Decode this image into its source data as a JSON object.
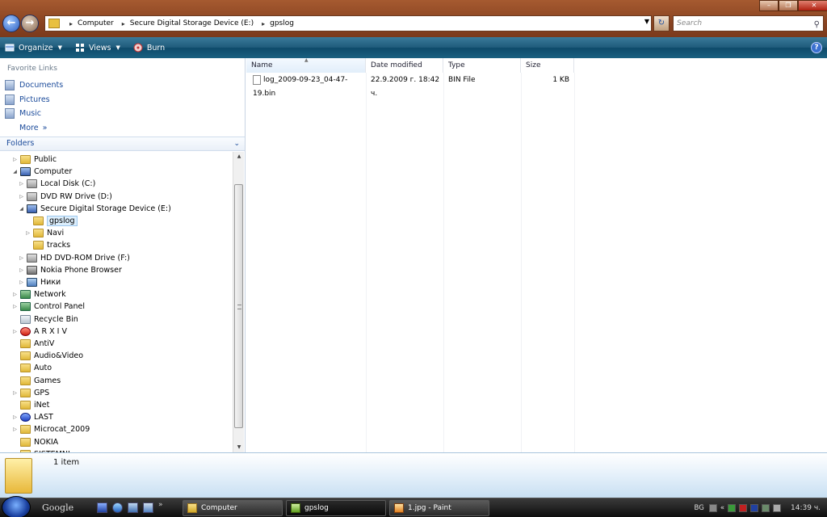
{
  "window": {
    "address": {
      "crumbs": [
        "Computer",
        "Secure Digital Storage Device (E:)",
        "gpslog"
      ],
      "separator": "▸"
    },
    "search_placeholder": "Search"
  },
  "toolbar": {
    "organize": "Organize",
    "views": "Views",
    "burn": "Burn",
    "help": "?"
  },
  "sidebar": {
    "favorites_heading": "Favorite Links",
    "favorites": [
      "Documents",
      "Pictures",
      "Music",
      "More"
    ],
    "more_suffix": "»",
    "folders_heading": "Folders",
    "tree": [
      {
        "label": "Public",
        "level": 1,
        "expander": "▷",
        "icon": "folder-icon"
      },
      {
        "label": "Computer",
        "level": 1,
        "expander": "◢",
        "icon": "computer-icon"
      },
      {
        "label": "Local Disk (C:)",
        "level": 2,
        "expander": "▷",
        "icon": "hard-drive-icon"
      },
      {
        "label": "DVD RW Drive (D:)",
        "level": 2,
        "expander": "▷",
        "icon": "dvd-drive-icon"
      },
      {
        "label": "Secure Digital Storage Device (E:)",
        "level": 2,
        "expander": "◢",
        "icon": "usb-drive-icon"
      },
      {
        "label": "gpslog",
        "level": 3,
        "expander": "",
        "icon": "folder-icon",
        "selected": true
      },
      {
        "label": "Navi",
        "level": 3,
        "expander": "▷",
        "icon": "folder-icon"
      },
      {
        "label": "tracks",
        "level": 3,
        "expander": "",
        "icon": "folder-icon"
      },
      {
        "label": "HD DVD-ROM Drive (F:)",
        "level": 2,
        "expander": "▷",
        "icon": "dvd-drive-icon"
      },
      {
        "label": "Nokia Phone Browser",
        "level": 2,
        "expander": "▷",
        "icon": "phone-icon"
      },
      {
        "label": "Ники",
        "level": 2,
        "expander": "▷",
        "icon": "user-folder-icon"
      },
      {
        "label": "Network",
        "level": 1,
        "expander": "▷",
        "icon": "network-icon"
      },
      {
        "label": "Control Panel",
        "level": 1,
        "expander": "▷",
        "icon": "control-panel-icon"
      },
      {
        "label": "Recycle Bin",
        "level": 1,
        "expander": "",
        "icon": "recycle-bin-icon"
      },
      {
        "label": "A R X I V",
        "level": 1,
        "expander": "▷",
        "icon": "archive-icon"
      },
      {
        "label": "AntiV",
        "level": 1,
        "expander": "",
        "icon": "folder-icon"
      },
      {
        "label": "Audio&Video",
        "level": 1,
        "expander": "",
        "icon": "folder-icon"
      },
      {
        "label": "Auto",
        "level": 1,
        "expander": "",
        "icon": "folder-icon"
      },
      {
        "label": "Games",
        "level": 1,
        "expander": "",
        "icon": "folder-icon"
      },
      {
        "label": "GPS",
        "level": 1,
        "expander": "▷",
        "icon": "folder-icon"
      },
      {
        "label": "iNet",
        "level": 1,
        "expander": "",
        "icon": "folder-icon"
      },
      {
        "label": "LAST",
        "level": 1,
        "expander": "▷",
        "icon": "help-circle-icon"
      },
      {
        "label": "Microcat_2009",
        "level": 1,
        "expander": "▷",
        "icon": "folder-icon"
      },
      {
        "label": "NOKIA",
        "level": 1,
        "expander": "",
        "icon": "folder-icon"
      },
      {
        "label": "SISTEMNI",
        "level": 1,
        "expander": "▷",
        "icon": "folder-icon"
      }
    ]
  },
  "filelist": {
    "columns": [
      "Name",
      "Date modified",
      "Type",
      "Size"
    ],
    "sort_indicator": "▲",
    "rows": [
      {
        "name": "log_2009-09-23_04-47-19.bin",
        "date": "22.9.2009 г. 18:42 ч.",
        "type": "BIN File",
        "size": "1 KB"
      }
    ]
  },
  "details": {
    "count": "1 item"
  },
  "taskbar": {
    "search_brand": "Google",
    "tasks": [
      "Computer",
      "gpslog",
      "1.jpg - Paint"
    ],
    "language": "BG",
    "clock": "14:39 ч.",
    "chevron": "«"
  }
}
